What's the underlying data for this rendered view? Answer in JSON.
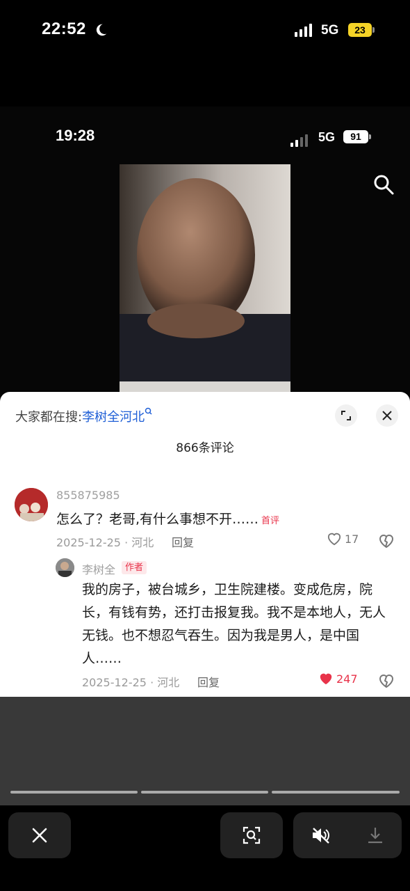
{
  "outer_status": {
    "time": "22:52",
    "network": "5G",
    "battery": "23"
  },
  "inner_status": {
    "time": "19:28",
    "network": "5G",
    "battery": "91"
  },
  "sheet": {
    "hot_search_prefix": "大家都在搜:",
    "hot_search_keyword": "李树全河北",
    "comment_count": "866条评论"
  },
  "comments": [
    {
      "username": "855875985",
      "text": "怎么了？老哥,有什么事想不开……",
      "badge": "首评",
      "meta": "2025-12-25 · 河北",
      "reply_label": "回复",
      "likes": "17"
    },
    {
      "username": "李树全",
      "badge": "作者",
      "text": "我的房子，被台城乡，卫生院建楼。变成危房，院长，有钱有势，还打击报复我。我不是本地人，无人无钱。也不想忍气吞生。因为我是男人，是中国人……",
      "meta": "2025-12-25 · 河北",
      "reply_label": "回复",
      "likes": "247"
    }
  ],
  "colors": {
    "accent": "#1f5fd6",
    "like_red": "#e8334a",
    "battery_yellow": "#f5d327"
  }
}
